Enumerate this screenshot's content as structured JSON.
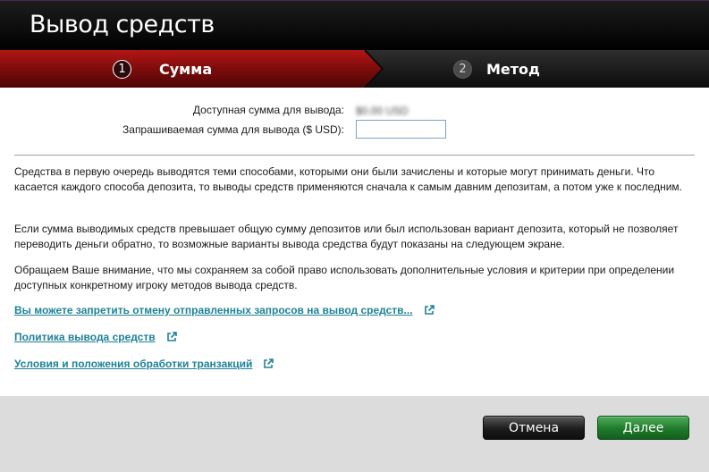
{
  "window": {
    "title": "Вывод средств"
  },
  "steps": [
    {
      "number": "1",
      "label": "Сумма",
      "state": "active"
    },
    {
      "number": "2",
      "label": "Метод",
      "state": "inactive"
    }
  ],
  "form": {
    "available_label": "Доступная сумма для вывода:",
    "available_value": "$0.00 USD",
    "requested_label": "Запрашиваемая сумма для вывода ($ USD):",
    "requested_value": ""
  },
  "info": {
    "paragraph_1": "Средства в первую очередь выводятся теми способами, которыми они были зачислены и которые могут принимать деньги. Что касается каждого способа депозита, то выводы средств применяются сначала к самым давним депозитам, а потом уже к последним.",
    "paragraph_2": "Если сумма выводимых средств превышает общую сумму депозитов или был использован вариант депозита, который не позволяет переводить деньги обратно, то возможные варианты вывода средства будут показаны на следующем экране.",
    "paragraph_3": "Обращаем Ваше внимание, что мы сохраняем за собой право использовать дополнительные условия и критерии при определении доступных конкретному игроку методов вывода средств."
  },
  "links": [
    {
      "label": "Вы можете запретить отмену отправленных запросов на вывод средств...",
      "icon": "external-link-icon"
    },
    {
      "label": "Политика вывода средств",
      "icon": "external-link-icon"
    },
    {
      "label": "Условия и положения обработки транзакций",
      "icon": "external-link-icon"
    }
  ],
  "buttons": {
    "cancel_label": "Отмена",
    "next_label": "Далее"
  },
  "colors": {
    "active_step": "#8a0f0f",
    "link": "#1d8298",
    "next_button": "#1e7a2a",
    "cancel_button": "#1c1c1c"
  }
}
